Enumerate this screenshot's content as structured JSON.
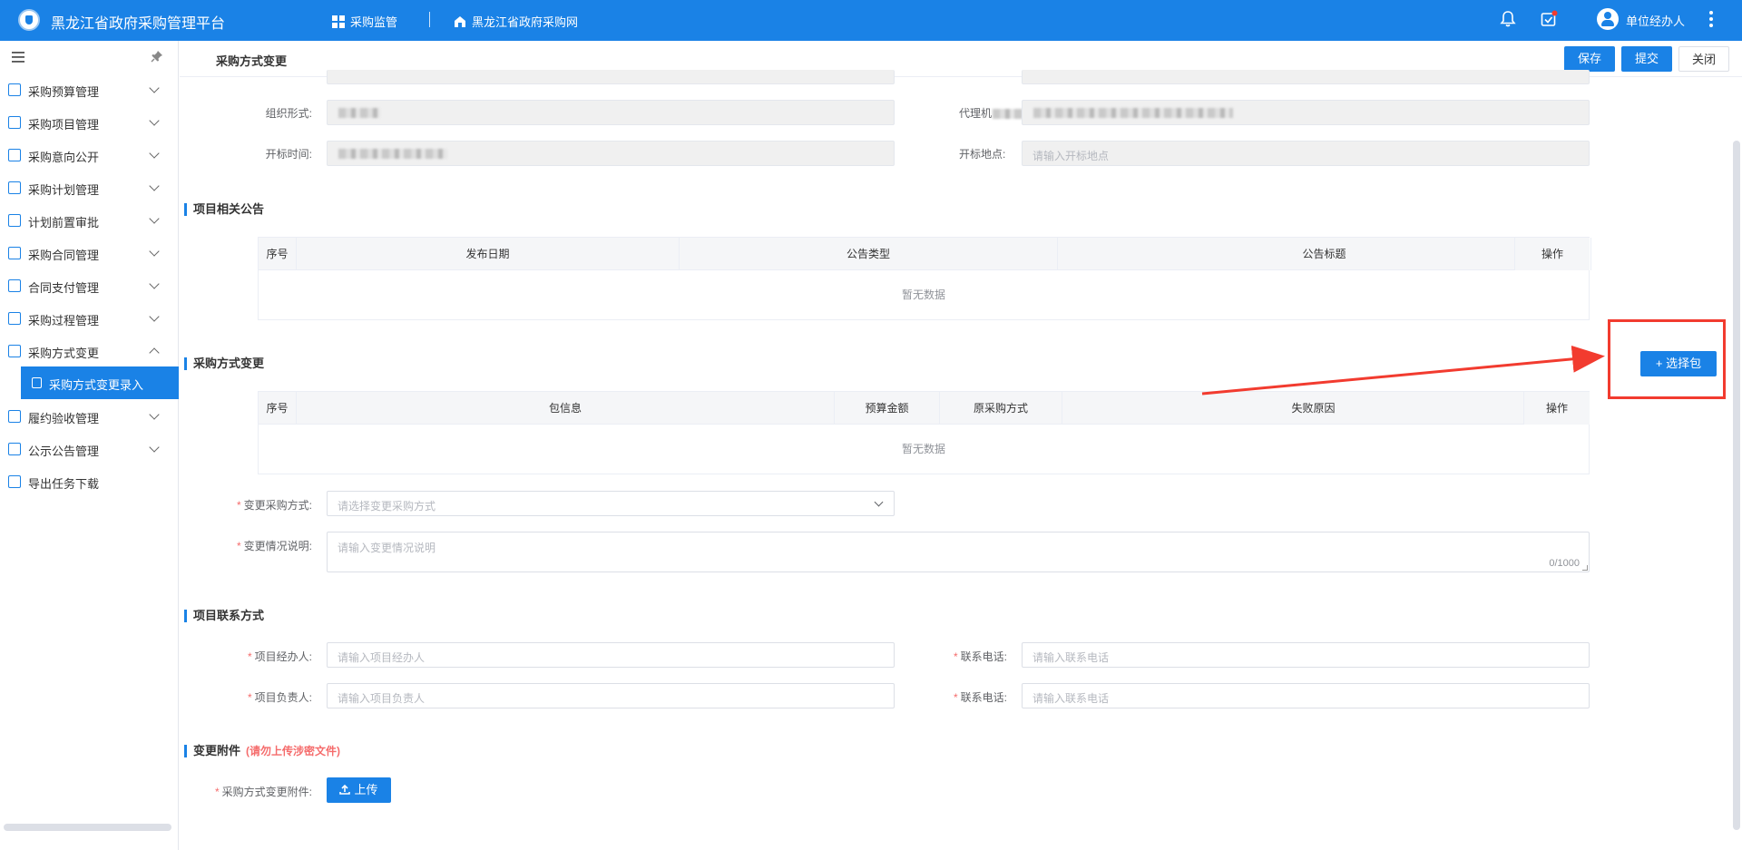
{
  "app": {
    "title": "黑龙江省政府采购管理平台",
    "nav": [
      {
        "label": "采购监管",
        "icon": "grid-icon"
      },
      {
        "label": "黑龙江省政府采购网",
        "icon": "home-icon"
      }
    ],
    "user": "单位经办人",
    "brand_color": "#1a82e6"
  },
  "sidebar": {
    "items": [
      {
        "label": "采购预算管理",
        "icon": "chart-icon"
      },
      {
        "label": "采购项目管理",
        "icon": "folder-icon"
      },
      {
        "label": "采购意向公开",
        "icon": "document-icon"
      },
      {
        "label": "采购计划管理",
        "icon": "checklist-icon"
      },
      {
        "label": "计划前置审批",
        "icon": "stamp-icon"
      },
      {
        "label": "采购合同管理",
        "icon": "contract-icon"
      },
      {
        "label": "合同支付管理",
        "icon": "payment-icon"
      },
      {
        "label": "采购过程管理",
        "icon": "process-icon"
      },
      {
        "label": "采购方式变更",
        "icon": "switch-icon",
        "expanded": true
      },
      {
        "label": "履约验收管理",
        "icon": "check-icon"
      },
      {
        "label": "公示公告管理",
        "icon": "notice-icon"
      },
      {
        "label": "导出任务下载",
        "icon": "export-icon"
      }
    ],
    "active_sub": "采购方式变更录入"
  },
  "header": {
    "title": "采购方式变更",
    "save": "保存",
    "submit": "提交",
    "close": "关闭"
  },
  "form_top": {
    "org_form_label": "组织形式:",
    "agency_label": "代理机",
    "open_time_label": "开标时间:",
    "open_place_label": "开标地点:",
    "open_place_placeholder": "请输入开标地点"
  },
  "notice_section": {
    "title": "项目相关公告",
    "columns": [
      "序号",
      "发布日期",
      "公告类型",
      "公告标题",
      "操作"
    ],
    "empty": "暂无数据"
  },
  "change_section": {
    "title": "采购方式变更",
    "select_button": "+ 选择包",
    "columns": [
      "序号",
      "包信息",
      "预算金额",
      "原采购方式",
      "失败原因",
      "操作"
    ],
    "empty": "暂无数据",
    "method_label": "变更采购方式:",
    "method_placeholder": "请选择变更采购方式",
    "desc_label": "变更情况说明:",
    "desc_placeholder": "请输入变更情况说明",
    "desc_counter": "0/1000"
  },
  "contact_section": {
    "title": "项目联系方式",
    "handler_label": "项目经办人:",
    "handler_placeholder": "请输入项目经办人",
    "phone1_label": "联系电话:",
    "phone1_placeholder": "请输入联系电话",
    "leader_label": "项目负责人:",
    "leader_placeholder": "请输入项目负责人",
    "phone2_label": "联系电话:",
    "phone2_placeholder": "请输入联系电话"
  },
  "attachment_section": {
    "title": "变更附件",
    "note": "(请勿上传涉密文件)",
    "label": "采购方式变更附件:",
    "upload": "上传"
  },
  "annotation": {
    "color": "#f23b2f"
  }
}
